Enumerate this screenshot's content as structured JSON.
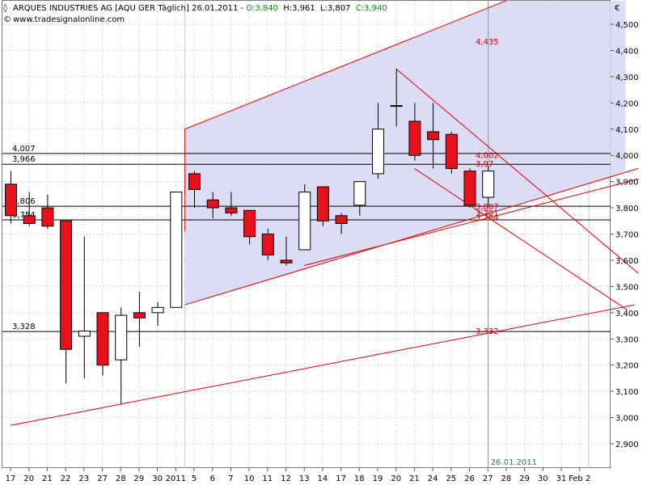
{
  "header": {
    "title": "ARQUES INDUSTRIES AG [AQU GER  Täglich] 26.01.2011 - ",
    "open": "O:3,840",
    "high": "H:3,961",
    "low": "L:3,807",
    "close": "C:3,940",
    "website": "www.tradesignalonline.com",
    "currency": "€"
  },
  "colors": {
    "up": "#ffffff",
    "down": "#e8101a",
    "channel_fill": "#d6d6f2",
    "trendline": "#e60000",
    "hline": "#000000",
    "cursor": "#6aaa8a",
    "green_text": "#009000",
    "red_text": "#d00000"
  },
  "chart_data": {
    "type": "candlestick",
    "title": "ARQUES INDUSTRIES AG [AQU GER  Täglich]",
    "ylim": [
      2.84,
      4.59
    ],
    "yticks": [
      2.9,
      3.0,
      3.1,
      3.2,
      3.3,
      3.4,
      3.5,
      3.6,
      3.7,
      3.8,
      3.9,
      4.0,
      4.1,
      4.2,
      4.3,
      4.4,
      4.5
    ],
    "ytick_labels": [
      "2,900",
      "3,000",
      "3,100",
      "3,200",
      "3,300",
      "3,400",
      "3,500",
      "3,600",
      "3,700",
      "3,800",
      "3,900",
      "4,000",
      "4,100",
      "4,200",
      "4,300",
      "4,400",
      "4,500"
    ],
    "x_labels": [
      "17",
      "20",
      "21",
      "22",
      "23",
      "27",
      "28",
      "29",
      "30",
      "2011",
      "5",
      "6",
      "7",
      "10",
      "11",
      "12",
      "13",
      "14",
      "17",
      "18",
      "19",
      "20",
      "21",
      "24",
      "25",
      "26",
      "27",
      "28",
      "29",
      "30",
      "31",
      "Feb 2"
    ],
    "candles": [
      {
        "x": 0,
        "open": 3.89,
        "high": 3.94,
        "low": 3.74,
        "close": 3.77
      },
      {
        "x": 1,
        "open": 3.77,
        "high": 3.86,
        "low": 3.73,
        "close": 3.74
      },
      {
        "x": 2,
        "open": 3.8,
        "high": 3.85,
        "low": 3.72,
        "close": 3.73
      },
      {
        "x": 3,
        "open": 3.75,
        "high": 3.75,
        "low": 3.13,
        "close": 3.26
      },
      {
        "x": 4,
        "open": 3.31,
        "high": 3.69,
        "low": 3.15,
        "close": 3.33
      },
      {
        "x": 5,
        "open": 3.4,
        "high": 3.4,
        "low": 3.16,
        "close": 3.2
      },
      {
        "x": 6,
        "open": 3.22,
        "high": 3.42,
        "low": 3.05,
        "close": 3.39
      },
      {
        "x": 7,
        "open": 3.4,
        "high": 3.48,
        "low": 3.27,
        "close": 3.38
      },
      {
        "x": 8,
        "open": 3.4,
        "high": 3.44,
        "low": 3.35,
        "close": 3.42
      },
      {
        "x": 9,
        "open": 3.42,
        "high": 3.86,
        "low": 3.42,
        "close": 3.86
      },
      {
        "x": 10,
        "open": 3.93,
        "high": 3.94,
        "low": 3.8,
        "close": 3.87
      },
      {
        "x": 11,
        "open": 3.83,
        "high": 3.86,
        "low": 3.76,
        "close": 3.8
      },
      {
        "x": 12,
        "open": 3.8,
        "high": 3.86,
        "low": 3.77,
        "close": 3.78
      },
      {
        "x": 13,
        "open": 3.79,
        "high": 3.79,
        "low": 3.66,
        "close": 3.69
      },
      {
        "x": 14,
        "open": 3.7,
        "high": 3.72,
        "low": 3.6,
        "close": 3.62
      },
      {
        "x": 15,
        "open": 3.6,
        "high": 3.69,
        "low": 3.58,
        "close": 3.59
      },
      {
        "x": 16,
        "open": 3.64,
        "high": 3.89,
        "low": 3.64,
        "close": 3.86
      },
      {
        "x": 17,
        "open": 3.88,
        "high": 3.88,
        "low": 3.73,
        "close": 3.75
      },
      {
        "x": 18,
        "open": 3.77,
        "high": 3.78,
        "low": 3.7,
        "close": 3.74
      },
      {
        "x": 19,
        "open": 3.81,
        "high": 3.9,
        "low": 3.77,
        "close": 3.9
      },
      {
        "x": 20,
        "open": 3.93,
        "high": 4.2,
        "low": 3.91,
        "close": 4.1
      },
      {
        "x": 21,
        "open": 4.19,
        "high": 4.33,
        "low": 4.11,
        "close": 4.19
      },
      {
        "x": 22,
        "open": 4.13,
        "high": 4.2,
        "low": 3.98,
        "close": 4.0
      },
      {
        "x": 23,
        "open": 4.09,
        "high": 4.2,
        "low": 3.95,
        "close": 4.06
      },
      {
        "x": 24,
        "open": 4.08,
        "high": 4.09,
        "low": 3.93,
        "close": 3.95
      },
      {
        "x": 25,
        "open": 3.94,
        "high": 3.95,
        "low": 3.8,
        "close": 3.81
      },
      {
        "x": 26,
        "open": 3.84,
        "high": 3.961,
        "low": 3.807,
        "close": 3.94
      }
    ],
    "horizontal_levels": [
      {
        "value": 4.007,
        "label": "4,007"
      },
      {
        "value": 3.966,
        "label": "3,966"
      },
      {
        "value": 3.806,
        "label": "3,806"
      },
      {
        "value": 3.754,
        "label": "3,754"
      },
      {
        "value": 3.328,
        "label": "3,328"
      }
    ],
    "trendlines": [
      {
        "from": [
          9.5,
          4.1
        ],
        "to": [
          27,
          4.59
        ],
        "name": "channel-top"
      },
      {
        "from": [
          9.5,
          3.43
        ],
        "to": [
          34.2,
          3.95
        ],
        "name": "channel-bottom"
      },
      {
        "from": [
          21,
          4.33
        ],
        "to": [
          34.2,
          3.55
        ],
        "name": "down-line-1"
      },
      {
        "from": [
          22,
          3.95
        ],
        "to": [
          33.6,
          3.41
        ],
        "name": "down-line-2"
      },
      {
        "from": [
          0,
          2.97
        ],
        "to": [
          34.0,
          3.43
        ],
        "name": "long-term-support"
      },
      {
        "from": [
          16,
          3.58
        ],
        "to": [
          34.2,
          3.91
        ],
        "name": "inner-support"
      }
    ],
    "right_labels": [
      {
        "value": 4.435,
        "label": "4,435"
      },
      {
        "value": 4.002,
        "label": "4,002"
      },
      {
        "value": 3.97,
        "label": "3,97"
      },
      {
        "value": 3.807,
        "label": "3,807"
      },
      {
        "value": 3.781,
        "label": "3,781"
      },
      {
        "value": 3.764,
        "label": "3,764"
      },
      {
        "value": 3.332,
        "label": "3,332"
      }
    ],
    "cursor": {
      "x": 26,
      "label": "26.01.2011"
    }
  }
}
